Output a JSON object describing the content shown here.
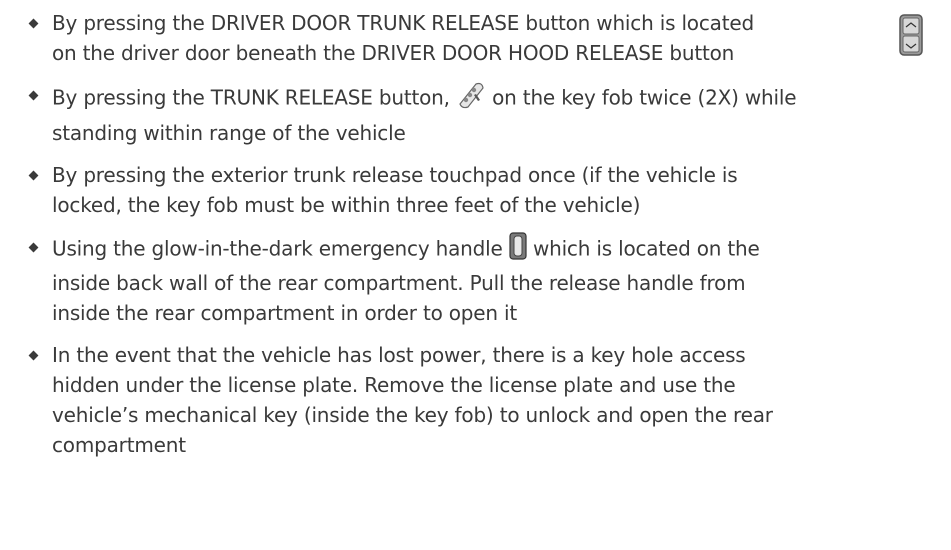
{
  "bullets": [
    {
      "line1": "By pressing the DRIVER DOOR TRUNK RELEASE button which is located",
      "line2": "on the driver door beneath the DRIVER DOOR HOOD RELEASE button",
      "icon": "door-switch-icon"
    },
    {
      "text_before": "By pressing the TRUNK RELEASE button,",
      "text_after": "on the key fob twice (2X) while",
      "line2": "standing within range of the vehicle",
      "icon": "key-fob-icon"
    },
    {
      "line1": "By pressing the exterior trunk release touchpad once (if the vehicle is",
      "line2": "locked, the key fob must be within three feet of the vehicle)"
    },
    {
      "text_before": "Using the glow-in-the-dark emergency handle",
      "text_after": "which is located on the",
      "line2": "inside back wall of the rear compartment. Pull the release handle from",
      "line3": "inside the rear compartment in order to open it",
      "icon": "emergency-handle-icon"
    },
    {
      "line1": "In the event that the vehicle has lost power, there is a key hole access",
      "line2": "hidden under the license plate. Remove the license plate and use the",
      "line3": "vehicle’s mechanical key (inside the key fob) to unlock and open the rear",
      "line4": "compartment"
    }
  ]
}
